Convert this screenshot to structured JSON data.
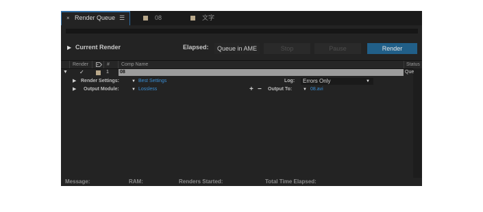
{
  "tabs": [
    {
      "label": "Render Queue",
      "close": "×",
      "menu": "☰"
    },
    {
      "label": "08"
    },
    {
      "label": "文字"
    }
  ],
  "colors": {
    "accent": "#2e6da4",
    "render_button": "#215f88",
    "label_swatch": "#b9a88a",
    "link": "#3a8fd6"
  },
  "current_render": {
    "label": "Current Render",
    "elapsed_label": "Elapsed:"
  },
  "buttons": {
    "queue_ame": "Queue in AME",
    "stop": "Stop",
    "pause": "Pause",
    "render": "Render"
  },
  "columns": {
    "render": "Render",
    "num": "#",
    "comp_name": "Comp Name",
    "status": "Status"
  },
  "queue_item": {
    "number": "1",
    "comp_name": "08",
    "status": "Que",
    "render_settings_label": "Render Settings:",
    "render_settings_value": "Best Settings",
    "log_label": "Log:",
    "log_value": "Errors Only",
    "output_module_label": "Output Module:",
    "output_module_value": "Lossless",
    "output_to_label": "Output To:",
    "output_to_value": "08.avi",
    "plus": "+",
    "minus": "−"
  },
  "footer": {
    "message": "Message:",
    "ram": "RAM:",
    "renders_started": "Renders Started:",
    "total_time": "Total Time Elapsed:"
  }
}
